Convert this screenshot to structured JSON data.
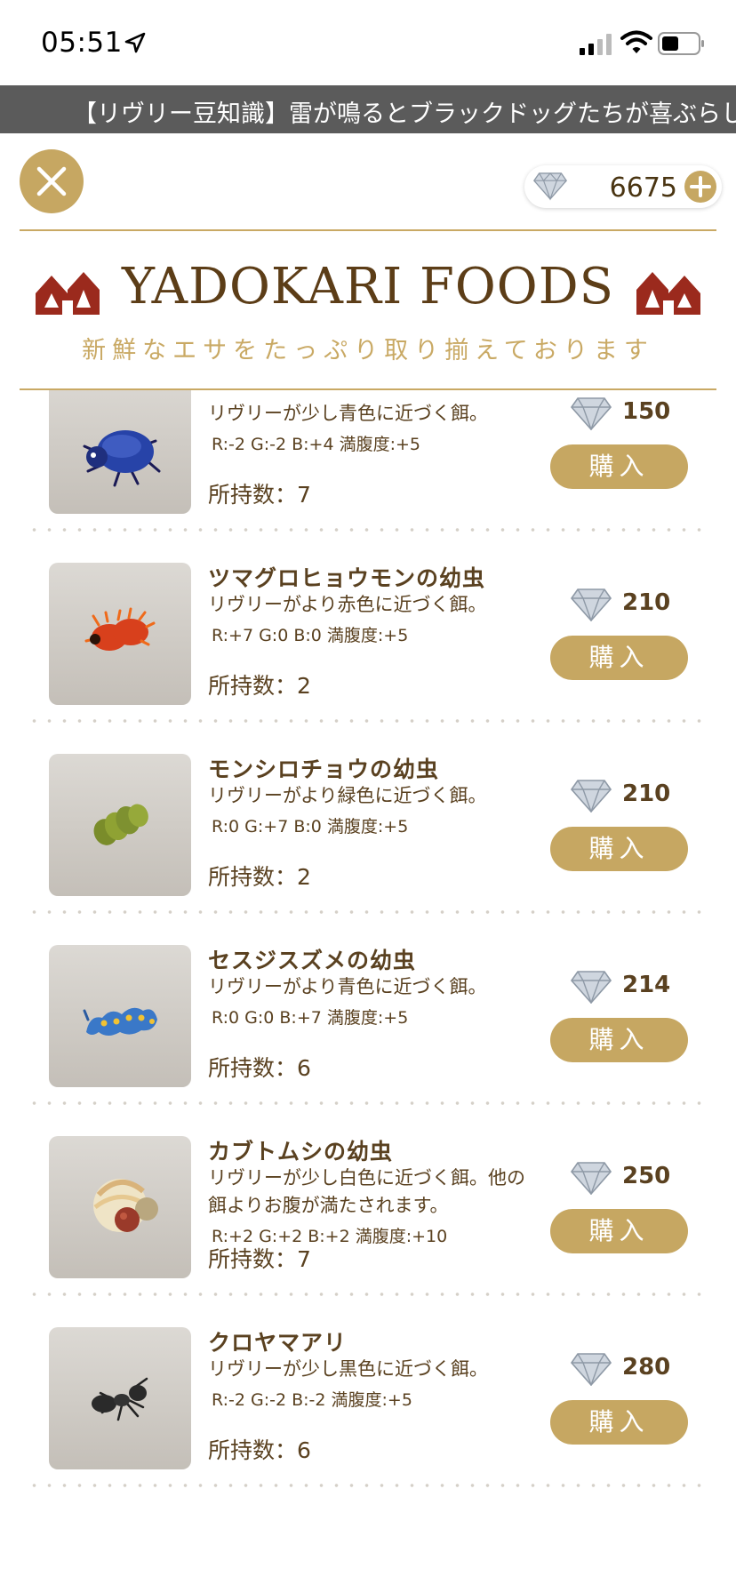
{
  "status_bar": {
    "time": "05:51"
  },
  "ticker": {
    "text": "【リヴリー豆知識】雷が鳴るとブラックドッグたちが喜ぶらしい"
  },
  "header": {
    "currency_value": "6675"
  },
  "logo": {
    "title": "YADOKARI FOODS",
    "subtitle": "新鮮なエサをたっぷり取り揃えております"
  },
  "owned_label": "所持数：",
  "buy_label": "購入",
  "items": [
    {
      "name": "",
      "desc": "リヴリーが少し青色に近づく餌。",
      "stats": "R:-2 G:-2 B:+4 満腹度:+5",
      "owned": "7",
      "price": "150",
      "icon": "beetle-icon"
    },
    {
      "name": "ツマグロヒョウモンの幼虫",
      "desc": "リヴリーがより赤色に近づく餌。",
      "stats": "R:+7 G:0 B:0 満腹度:+5",
      "owned": "2",
      "price": "210",
      "icon": "red-caterpillar-icon"
    },
    {
      "name": "モンシロチョウの幼虫",
      "desc": "リヴリーがより緑色に近づく餌。",
      "stats": "R:0 G:+7 B:0 満腹度:+5",
      "owned": "2",
      "price": "210",
      "icon": "green-caterpillar-icon"
    },
    {
      "name": "セスジスズメの幼虫",
      "desc": "リヴリーがより青色に近づく餌。",
      "stats": "R:0 G:0 B:+7 満腹度:+5",
      "owned": "6",
      "price": "214",
      "icon": "blue-caterpillar-icon"
    },
    {
      "name": "カブトムシの幼虫",
      "desc": "リヴリーが少し白色に近づく餌。他の餌よりお腹が満たされます。",
      "stats": "R:+2 G:+2 B:+2 満腹度:+10",
      "owned": "7",
      "price": "250",
      "icon": "grub-icon"
    },
    {
      "name": "クロヤマアリ",
      "desc": "リヴリーが少し黒色に近づく餌。",
      "stats": "R:-2 G:-2 B:-2 満腹度:+5",
      "owned": "6",
      "price": "280",
      "icon": "ant-icon"
    }
  ]
}
